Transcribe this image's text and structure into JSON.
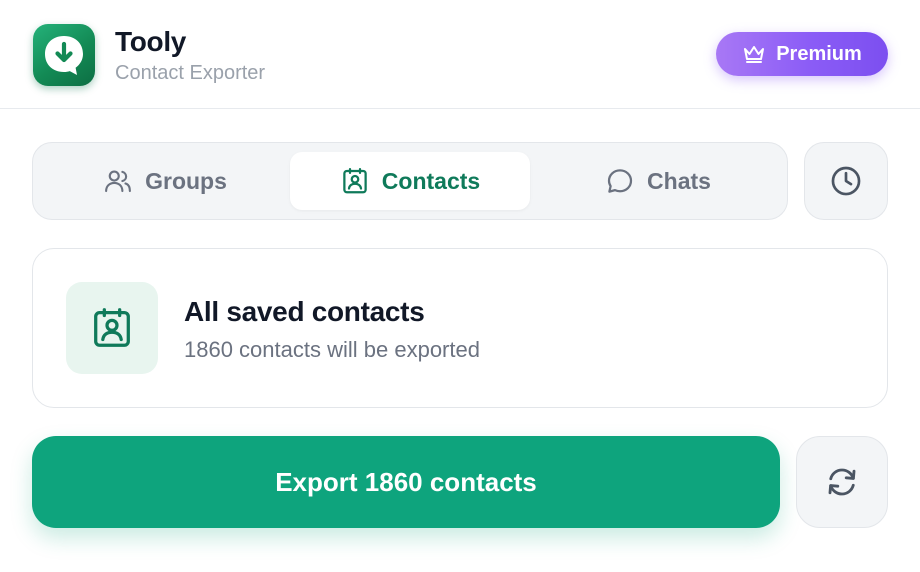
{
  "header": {
    "title": "Tooly",
    "subtitle": "Contact Exporter",
    "premium_label": "Premium"
  },
  "tabs": [
    {
      "label": "Groups",
      "icon": "users-icon",
      "active": false
    },
    {
      "label": "Contacts",
      "icon": "contact-card-icon",
      "active": true
    },
    {
      "label": "Chats",
      "icon": "chat-bubble-icon",
      "active": false
    }
  ],
  "history_icon": "clock-icon",
  "card": {
    "title": "All saved contacts",
    "subtitle": "1860 contacts will be exported",
    "icon": "contact-card-icon"
  },
  "export": {
    "label": "Export 1860 contacts"
  },
  "refresh_icon": "refresh-icon",
  "colors": {
    "accent": "#0ea47d",
    "accent_dark": "#0f7a5a",
    "premium": "#8b5cf6",
    "logo": "#138a55"
  }
}
